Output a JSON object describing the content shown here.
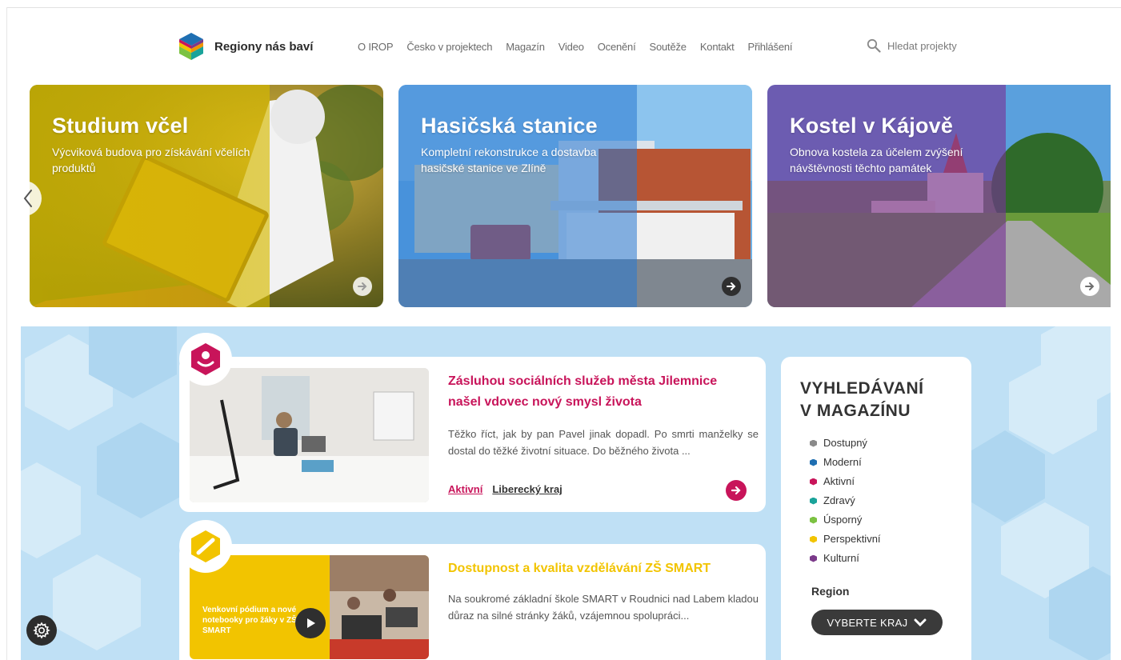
{
  "brand": {
    "name": "Regiony nás baví"
  },
  "nav": {
    "items": [
      "O IROP",
      "Česko v projektech",
      "Magazín",
      "Video",
      "Ocenění",
      "Soutěže",
      "Kontakt",
      "Přihlášení"
    ],
    "search_label": "Hledat projekty"
  },
  "carousel": {
    "cards": [
      {
        "title": "Studium včel",
        "desc": "Výcviková budova pro získávání včelích produktů"
      },
      {
        "title": "Hasičská stanice",
        "desc": "Kompletní rekonstrukce a dostavba hasičské stanice ve Zlíně"
      },
      {
        "title": "Kostel v Kájově",
        "desc": "Obnova kostela za účelem zvýšení návštěvnosti těchto památek"
      }
    ]
  },
  "articles": [
    {
      "title": "Zásluhou sociálních služeb města Jilemnice našel vdovec nový smysl života",
      "text": "Těžko říct, jak by pan Pavel jinak dopadl. Po smrti manželky se dostal do těžké životní situace. Do běžného života ...",
      "tags": [
        "Aktivní",
        "Liberecký kraj"
      ],
      "accent": "#c8145a"
    },
    {
      "title": "Dostupnost a kvalita vzdělávání ZŠ SMART",
      "text": "Na soukromé základní škole SMART v Roudnici nad Labem kladou důraz na silné stránky žáků, vzájemnou spolupráci...",
      "image_caption": "Venkovní pódium a nové notebooky pro žáky v ZŠ SMART",
      "accent": "#f2c400"
    }
  ],
  "sidebar": {
    "title_line1": "VYHLEDÁVANÍ",
    "title_line2": "V MAGAZÍNU",
    "categories": [
      {
        "label": "Dostupný",
        "color": "#8a8a8a"
      },
      {
        "label": "Moderní",
        "color": "#1f6fb2"
      },
      {
        "label": "Aktivní",
        "color": "#c8145a"
      },
      {
        "label": "Zdravý",
        "color": "#1aa39a"
      },
      {
        "label": "Úsporný",
        "color": "#7cc242"
      },
      {
        "label": "Perspektivní",
        "color": "#f2c400"
      },
      {
        "label": "Kulturní",
        "color": "#7b3a8a"
      }
    ],
    "region_label": "Region",
    "region_button": "VYBERTE KRAJ"
  },
  "icons": {
    "search": "magnifier-icon",
    "settings": "gear-icon",
    "prev": "chevron-left-icon",
    "next": "arrow-right-icon"
  }
}
